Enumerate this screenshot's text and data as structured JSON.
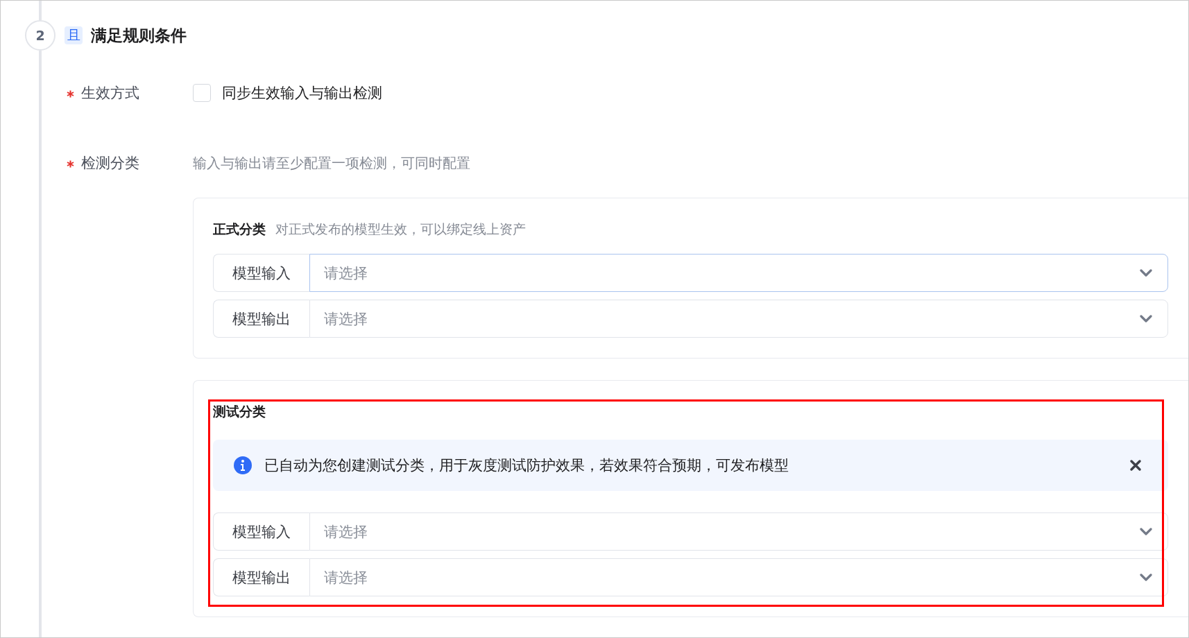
{
  "step": {
    "number": "2",
    "badge": "且",
    "title": "满足规则条件"
  },
  "fields": [
    {
      "kind": "checkbox",
      "label": "生效方式",
      "required": true,
      "checked": false,
      "text": "同步生效输入与输出检测"
    },
    {
      "kind": "hint",
      "label": "检测分类",
      "required": true,
      "text": "输入与输出请至少配置一项检测，可同时配置"
    }
  ],
  "cards": [
    {
      "title": "正式分类",
      "description": "对正式发布的模型生效，可以绑定线上资产",
      "highlighted": false,
      "selects": [
        {
          "label": "模型输入",
          "placeholder": "请选择",
          "focused": true
        },
        {
          "label": "模型输出",
          "placeholder": "请选择",
          "focused": false
        }
      ]
    },
    {
      "title": "测试分类",
      "highlighted": true,
      "alert": {
        "text": "已自动为您创建测试分类，用于灰度测试防护效果，若效果符合预期，可发布模型"
      },
      "selects": [
        {
          "label": "模型输入",
          "placeholder": "请选择",
          "focused": false
        },
        {
          "label": "模型输出",
          "placeholder": "请选择",
          "focused": false
        }
      ]
    }
  ]
}
